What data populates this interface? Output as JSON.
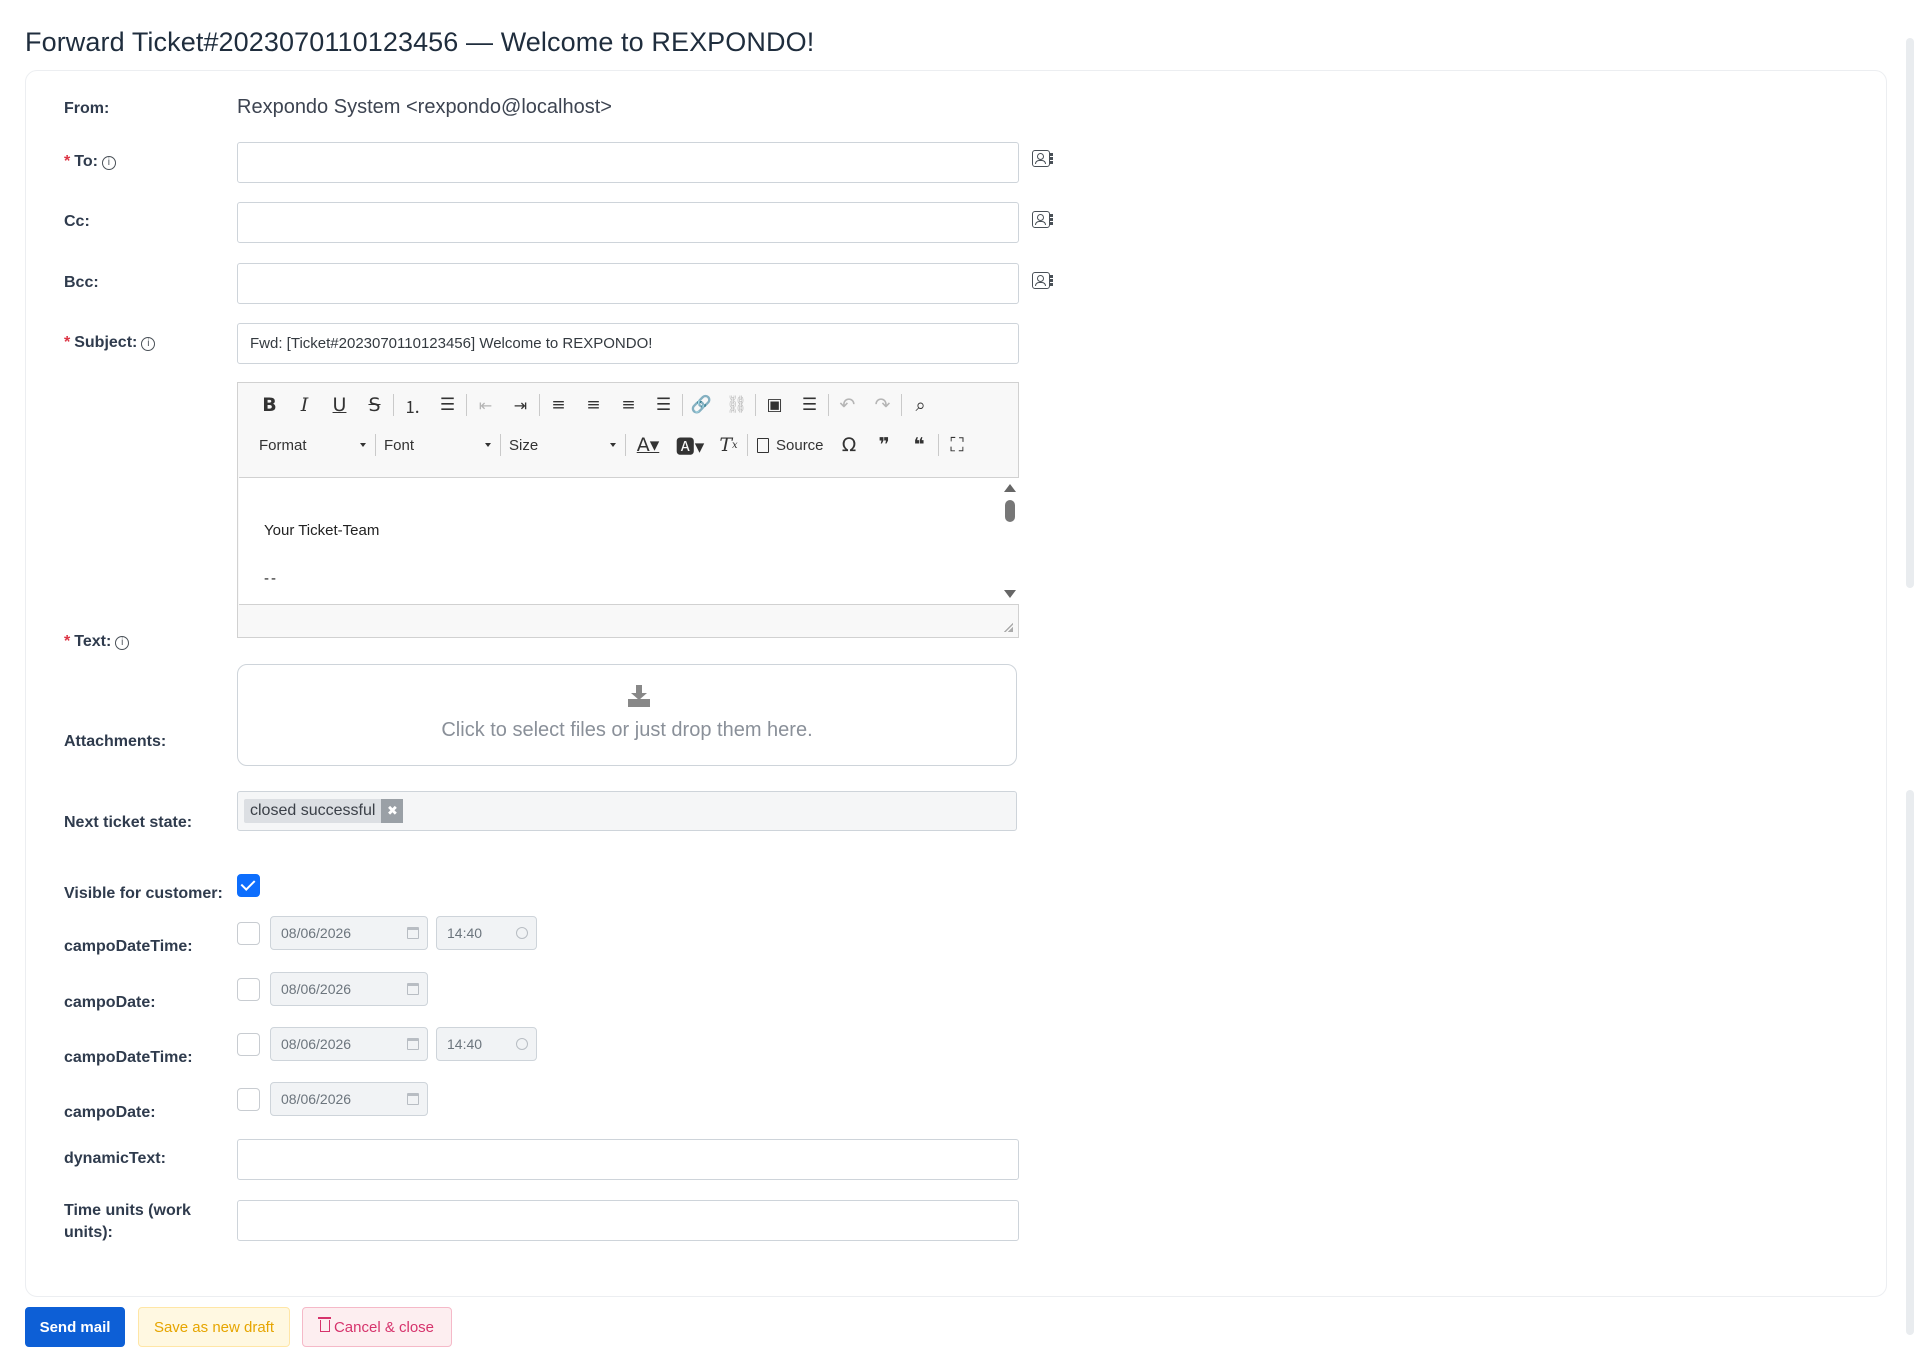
{
  "title": "Forward Ticket#2023070110123456 — Welcome to REXPONDO!",
  "form": {
    "from_label": "From:",
    "from_value": "Rexpondo System <rexpondo@localhost>",
    "to_label": "To:",
    "cc_label": "Cc:",
    "bcc_label": "Bcc:",
    "subject_label": "Subject:",
    "subject_value": "Fwd: [Ticket#2023070110123456] Welcome to REXPONDO!",
    "text_label": "Text:",
    "attachments_label": "Attachments:",
    "next_state_label": "Next ticket state:",
    "visible_label": "Visible for customer:",
    "dynamic_text_label": "dynamicText:",
    "time_units_label": "Time units (work units):"
  },
  "editor": {
    "format_label": "Format",
    "font_label": "Font",
    "size_label": "Size",
    "source_label": "Source",
    "body_line1": "Your Ticket-Team",
    "body_line2": "--"
  },
  "attachments": {
    "dropzone_text": "Click to select files or just drop them here."
  },
  "next_state": {
    "selected": "closed successful",
    "remove_glyph": "✖"
  },
  "visible_for_customer": true,
  "date_fields": [
    {
      "label": "campoDateTime:",
      "date": "08/06/2026",
      "time": "14:40",
      "checked": false
    },
    {
      "label": "campoDate:",
      "date": "08/06/2026",
      "checked": false
    },
    {
      "label": "campoDateTime:",
      "date": "08/06/2026",
      "time": "14:40",
      "checked": false
    },
    {
      "label": "campoDate:",
      "date": "08/06/2026",
      "checked": false
    }
  ],
  "actions": {
    "send": "Send mail",
    "draft": "Save as new draft",
    "cancel": "Cancel & close"
  },
  "colors": {
    "primary": "#0d5fd6",
    "warning": "#e6a500",
    "danger": "#d6336c",
    "required": "#dc3545"
  }
}
